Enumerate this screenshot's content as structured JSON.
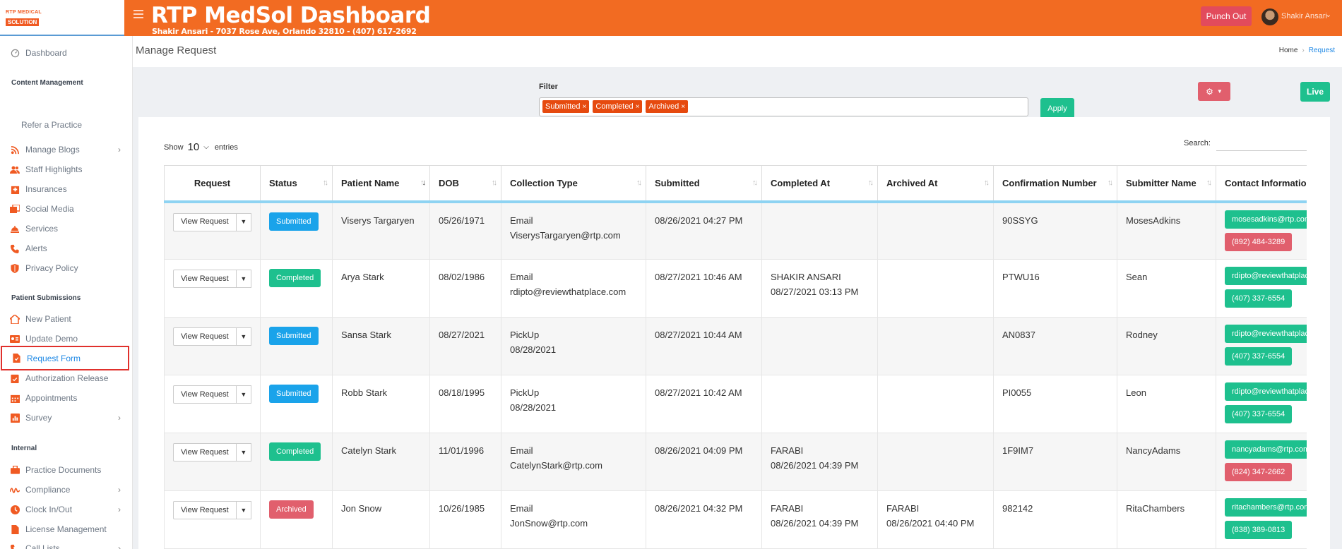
{
  "logo": {
    "top": "RTP MEDICAL",
    "main": "SOLUTION"
  },
  "header": {
    "title": "RTP MedSol Dashboard",
    "subtitle": "Shakir Ansari - 7037 Rose Ave, Orlando 32810 - (407) 617-2692",
    "punch_label": "Punch Out",
    "user_name": "Shakir Ansari"
  },
  "sidebar": {
    "dashboard": "Dashboard",
    "sections": {
      "content": "Content Management",
      "patient": "Patient Submissions",
      "internal": "Internal"
    },
    "items": {
      "refer": "Refer a Practice",
      "blogs": "Manage Blogs",
      "staff": "Staff Highlights",
      "insurances": "Insurances",
      "social": "Social Media",
      "services": "Services",
      "alerts": "Alerts",
      "privacy": "Privacy Policy",
      "new_patient": "New Patient",
      "update_demo": "Update Demo",
      "request_form": "Request Form",
      "auth_release": "Authorization Release",
      "appointments": "Appointments",
      "survey": "Survey",
      "practice_docs": "Practice Documents",
      "compliance": "Compliance",
      "clock": "Clock In/Out",
      "license": "License Management",
      "call_lists": "Call Lists"
    }
  },
  "page": {
    "title": "Manage Request",
    "breadcrumb_home": "Home",
    "breadcrumb_current": "Request"
  },
  "filter": {
    "label": "Filter",
    "chips": [
      "Submitted",
      "Completed",
      "Archived"
    ],
    "apply": "Apply"
  },
  "live_label": "Live",
  "table_controls": {
    "show": "Show",
    "entries_value": "10",
    "entries": "entries",
    "search": "Search:"
  },
  "columns": [
    "Request",
    "Status",
    "Patient Name",
    "DOB",
    "Collection Type",
    "Submitted",
    "Completed At",
    "Archived At",
    "Confirmation Number",
    "Submitter Name",
    "Contact Information"
  ],
  "view_request_label": "View Request",
  "rows": [
    {
      "status": "Submitted",
      "patient": "Viserys Targaryen",
      "dob": "05/26/1971",
      "collection1": "Email",
      "collection2": "ViserysTargaryen@rtp.com",
      "submitted": "08/26/2021 04:27 PM",
      "completed1": "",
      "completed2": "",
      "archived1": "",
      "archived2": "",
      "confirmation": "90SSYG",
      "submitter": "MosesAdkins",
      "email": "mosesadkins@rtp.com",
      "phone": "(892) 484-3289",
      "phone_color": "red"
    },
    {
      "status": "Completed",
      "patient": "Arya Stark",
      "dob": "08/02/1986",
      "collection1": "Email",
      "collection2": "rdipto@reviewthatplace.com",
      "submitted": "08/27/2021 10:46 AM",
      "completed1": "SHAKIR ANSARI",
      "completed2": "08/27/2021 03:13 PM",
      "archived1": "",
      "archived2": "",
      "confirmation": "PTWU16",
      "submitter": "Sean",
      "email": "rdipto@reviewthatplace.com",
      "phone": "(407) 337-6554",
      "phone_color": "green"
    },
    {
      "status": "Submitted",
      "patient": "Sansa Stark",
      "dob": "08/27/2021",
      "collection1": "PickUp",
      "collection2": "08/28/2021",
      "submitted": "08/27/2021 10:44 AM",
      "completed1": "",
      "completed2": "",
      "archived1": "",
      "archived2": "",
      "confirmation": "AN0837",
      "submitter": "Rodney",
      "email": "rdipto@reviewthatplace.com",
      "phone": "(407) 337-6554",
      "phone_color": "green"
    },
    {
      "status": "Submitted",
      "patient": "Robb Stark",
      "dob": "08/18/1995",
      "collection1": "PickUp",
      "collection2": "08/28/2021",
      "submitted": "08/27/2021 10:42 AM",
      "completed1": "",
      "completed2": "",
      "archived1": "",
      "archived2": "",
      "confirmation": "PI0055",
      "submitter": "Leon",
      "email": "rdipto@reviewthatplace.com",
      "phone": "(407) 337-6554",
      "phone_color": "green"
    },
    {
      "status": "Completed",
      "patient": "Catelyn Stark",
      "dob": "11/01/1996",
      "collection1": "Email",
      "collection2": "CatelynStark@rtp.com",
      "submitted": "08/26/2021 04:09 PM",
      "completed1": "FARABI",
      "completed2": "08/26/2021 04:39 PM",
      "archived1": "",
      "archived2": "",
      "confirmation": "1F9IM7",
      "submitter": "NancyAdams",
      "email": "nancyadams@rtp.com",
      "phone": "(824) 347-2662",
      "phone_color": "red"
    },
    {
      "status": "Archived",
      "patient": "Jon Snow",
      "dob": "10/26/1985",
      "collection1": "Email",
      "collection2": "JonSnow@rtp.com",
      "submitted": "08/26/2021 04:32 PM",
      "completed1": "FARABI",
      "completed2": "08/26/2021 04:39 PM",
      "archived1": "FARABI",
      "archived2": "08/26/2021 04:40 PM",
      "confirmation": "982142",
      "submitter": "RitaChambers",
      "email": "ritachambers@rtp.com",
      "phone": "(838) 389-0813",
      "phone_color": "green"
    }
  ],
  "colors": {
    "brand": "#f26b22",
    "submitted": "#1aa3ea",
    "completed": "#1ec08e",
    "archived": "#e15f6d"
  }
}
